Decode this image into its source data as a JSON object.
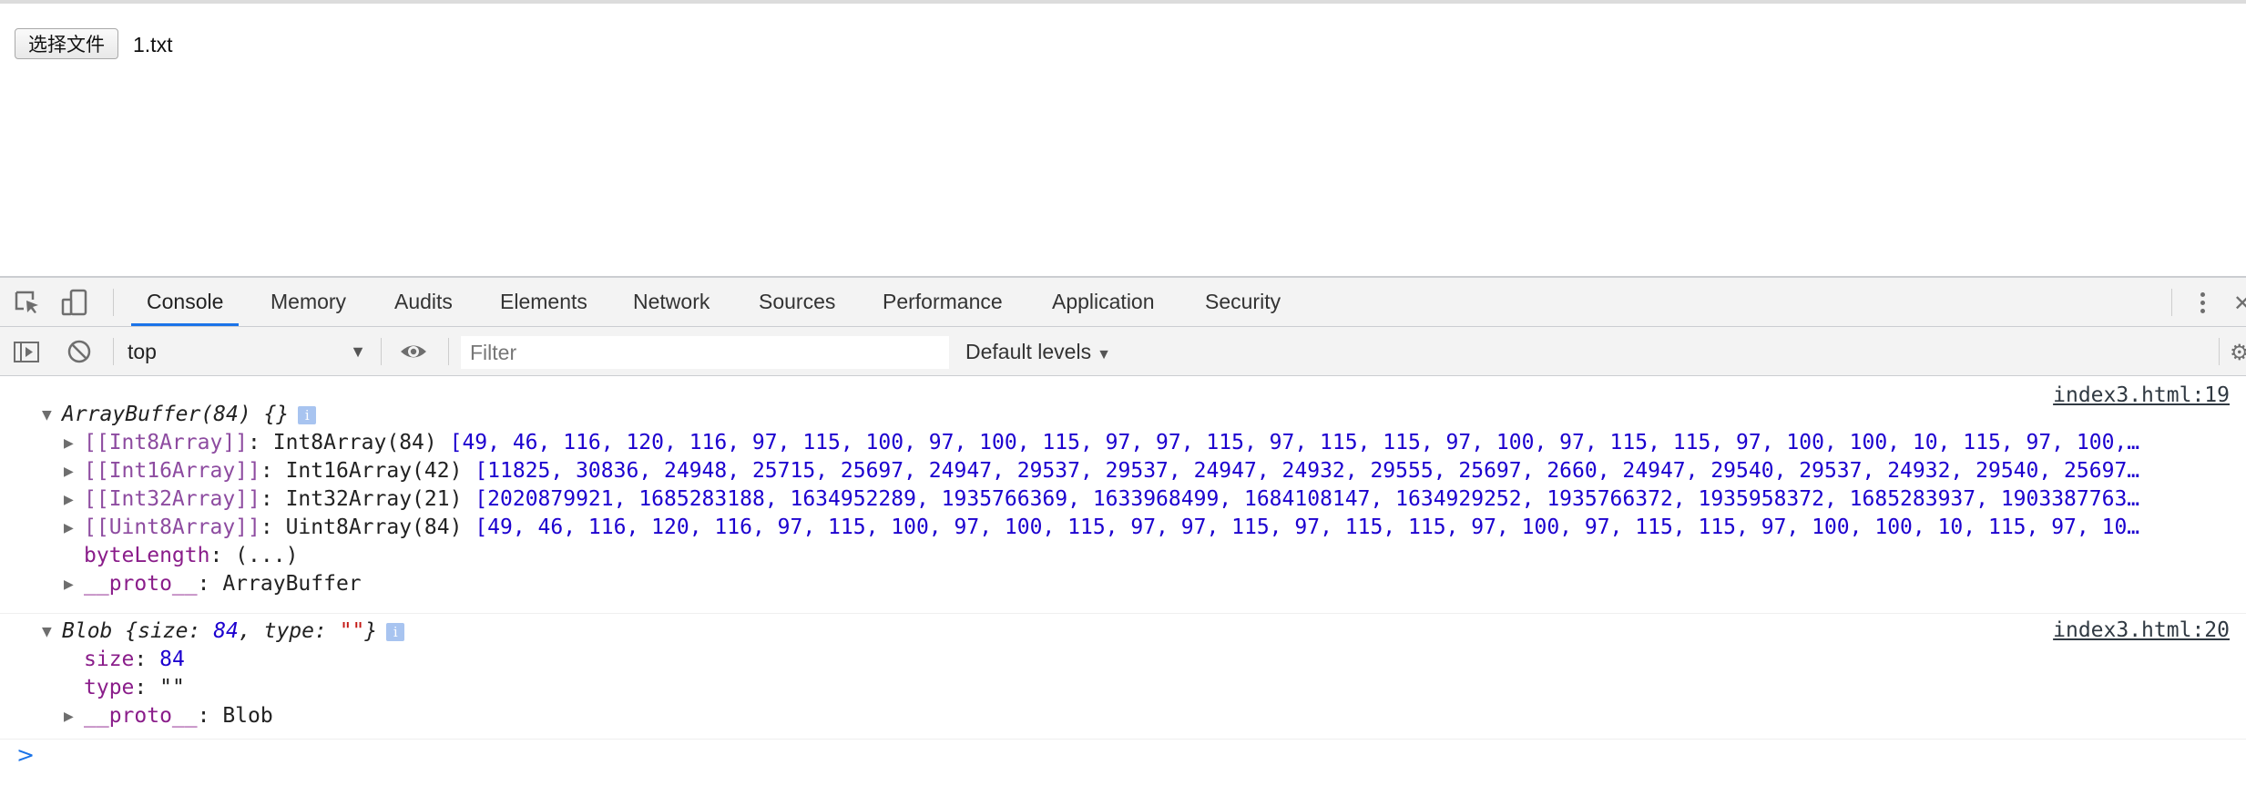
{
  "page": {
    "file_button": "选择文件",
    "file_name": "1.txt"
  },
  "devtools": {
    "tabs": [
      "Console",
      "Memory",
      "Audits",
      "Elements",
      "Network",
      "Sources",
      "Performance",
      "Application",
      "Security"
    ],
    "active_tab": "Console",
    "context": "top",
    "filter_placeholder": "Filter",
    "levels": "Default levels"
  },
  "console": {
    "msg1": {
      "source": "index3.html:19",
      "header": "ArrayBuffer(84) {}",
      "rows": [
        {
          "key": "[[Int8Array]]",
          "type": "Int8Array(84)",
          "values": "[49, 46, 116, 120, 116, 97, 115, 100, 97, 100, 115, 97, 97, 115, 97, 115, 115, 97, 100, 97, 115, 115, 97, 100, 100, 10, 115, 97, 100,…"
        },
        {
          "key": "[[Int16Array]]",
          "type": "Int16Array(42)",
          "values": "[11825, 30836, 24948, 25715, 25697, 24947, 29537, 29537, 24947, 24932, 29555, 25697, 2660, 24947, 29540, 29537, 24932, 29540, 25697…"
        },
        {
          "key": "[[Int32Array]]",
          "type": "Int32Array(21)",
          "values": "[2020879921, 1685283188, 1634952289, 1935766369, 1633968499, 1684108147, 1634929252, 1935766372, 1935958372, 1685283937, 1903387763…"
        },
        {
          "key": "[[Uint8Array]]",
          "type": "Uint8Array(84)",
          "values": "[49, 46, 116, 120, 116, 97, 115, 100, 97, 100, 115, 97, 97, 115, 97, 115, 115, 97, 100, 97, 115, 115, 97, 100, 100, 10, 115, 97, 10…"
        }
      ],
      "byte_length_key": "byteLength",
      "byte_length_value": "(...)",
      "proto_key": "__proto__",
      "proto_value": "ArrayBuffer"
    },
    "msg2": {
      "source": "index3.html:20",
      "header_name": "Blob",
      "header_size_key": "size",
      "header_size_value": "84",
      "header_type_key": "type",
      "header_type_value": "\"\"",
      "size_key": "size",
      "size_value": "84",
      "type_key": "type",
      "type_value": "\"\"",
      "proto_key": "__proto__",
      "proto_value": "Blob"
    },
    "prompt": ">"
  }
}
